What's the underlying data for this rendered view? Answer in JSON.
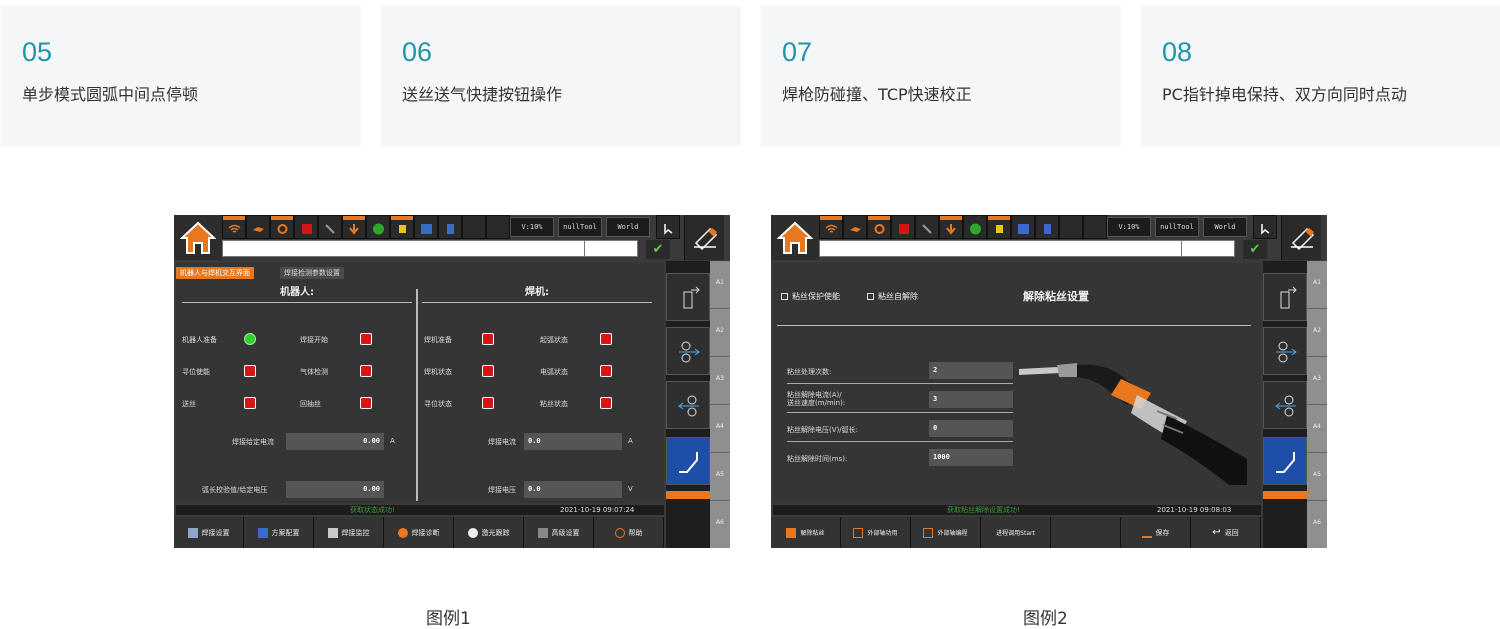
{
  "features": [
    {
      "num": "05",
      "desc": "单步模式圆弧中间点停顿"
    },
    {
      "num": "06",
      "desc": "送丝送气快捷按钮操作"
    },
    {
      "num": "07",
      "desc": "焊枪防碰撞、TCP快速校正"
    },
    {
      "num": "08",
      "desc": "PC指针掉电保持、双方向同时点动"
    }
  ],
  "captions": [
    "图例1",
    "图例2"
  ],
  "topbar": {
    "speed": "V:10%",
    "tool": "nullTool",
    "frame": "World",
    "ok_icon": "check-icon"
  },
  "rail_tabs": [
    "A1",
    "A2",
    "A3",
    "A4",
    "A5",
    "A6"
  ],
  "screen1": {
    "tabs": [
      "机器人与焊机交互界面",
      "焊接检测参数设置"
    ],
    "robot_title": "机器人:",
    "welder_title": "焊机:",
    "robot_signals": [
      {
        "label": "机器人准备",
        "state": "green"
      },
      {
        "label": "焊接开始",
        "state": "red"
      },
      {
        "label": "寻位使能",
        "state": "red"
      },
      {
        "label": "气体检测",
        "state": "red"
      },
      {
        "label": "送丝",
        "state": "red"
      },
      {
        "label": "回抽丝",
        "state": "red"
      }
    ],
    "welder_signals": [
      {
        "label": "焊机准备",
        "state": "red"
      },
      {
        "label": "起弧状态",
        "state": "red"
      },
      {
        "label": "焊机状态",
        "state": "red"
      },
      {
        "label": "电弧状态",
        "state": "red"
      },
      {
        "label": "寻位状态",
        "state": "red"
      },
      {
        "label": "粘丝状态",
        "state": "red"
      }
    ],
    "set_current_label": "焊接给定电流",
    "set_current_value": "0.00",
    "set_current_unit": "A",
    "set_voltage_label": "弧长校验值/给定电压",
    "set_voltage_value": "0.00",
    "weld_current_label": "焊接电流",
    "weld_current_value": "0.0",
    "weld_current_unit": "A",
    "weld_voltage_label": "焊接电压",
    "weld_voltage_value": "0.0",
    "weld_voltage_unit": "V",
    "status_message": "获取状态成功!",
    "timestamp": "2021-10-19 09:07:24",
    "buttons": [
      "焊接设置",
      "方案配置",
      "焊接监控",
      "焊接诊断",
      "激光跟踪",
      "高级设置",
      "帮助"
    ]
  },
  "screen2": {
    "check1": "粘丝保护使能",
    "check2": "粘丝自解除",
    "title": "解除粘丝设置",
    "params": [
      {
        "label": "粘丝处理次数:",
        "value": "2"
      },
      {
        "label": "粘丝解除电流(A)/\n送丝速度(m/min):",
        "value": "3"
      },
      {
        "label": "粘丝解除电压(V)/弧长:",
        "value": "0"
      },
      {
        "label": "粘丝解除时间(ms):",
        "value": "1000"
      }
    ],
    "status_message": "获取粘丝解除设置成功!",
    "timestamp": "2021-10-19 09:08:03",
    "buttons": [
      "解除粘丝",
      "外部轴功用",
      "外部轴编程",
      "进程调用Start",
      "",
      "保存",
      "返回"
    ]
  }
}
